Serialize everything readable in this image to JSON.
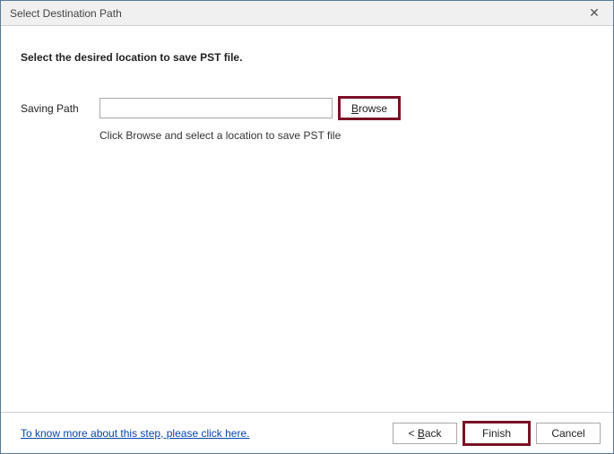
{
  "window": {
    "title": "Select Destination Path",
    "close_glyph": "✕"
  },
  "main": {
    "heading": "Select the desired location to save PST file.",
    "saving_path_label": "Saving Path",
    "saving_path_value": "",
    "browse_accel": "B",
    "browse_rest": "rowse",
    "hint": "Click Browse and select a location to save PST file"
  },
  "footer": {
    "help_link": "To know more about this step, please click here.",
    "back_prefix": "< ",
    "back_accel": "B",
    "back_rest": "ack",
    "finish_label": "Finish",
    "cancel_label": "Cancel"
  }
}
